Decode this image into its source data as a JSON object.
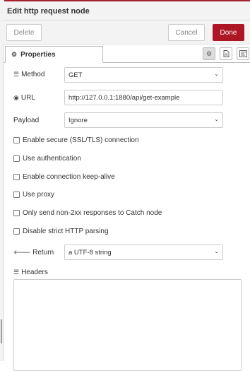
{
  "tray": {
    "title": "Edit http request node"
  },
  "toolbar": {
    "delete_label": "Delete",
    "cancel_label": "Cancel",
    "done_label": "Done"
  },
  "tabs": {
    "properties_label": "Properties"
  },
  "form": {
    "method": {
      "label": "Method",
      "value": "GET"
    },
    "url": {
      "label": "URL",
      "value": "http://127.0.0.1:1880/api/get-example"
    },
    "payload": {
      "label": "Payload",
      "value": "Ignore"
    },
    "checks": [
      {
        "label": "Enable secure (SSL/TLS) connection",
        "checked": false
      },
      {
        "label": "Use authentication",
        "checked": false
      },
      {
        "label": "Enable connection keep-alive",
        "checked": false
      },
      {
        "label": "Use proxy",
        "checked": false
      },
      {
        "label": "Only send non-2xx responses to Catch node",
        "checked": false
      },
      {
        "label": "Disable strict HTTP parsing",
        "checked": false
      }
    ],
    "ret": {
      "label": "Return",
      "value": "a UTF-8 string"
    },
    "headers": {
      "label": "Headers"
    }
  },
  "icons": {
    "tab_properties": "gear-icon",
    "method": "list-icon",
    "url": "globe-icon",
    "ret": "arrow-left-icon",
    "headers": "list-icon",
    "tab1": "gear-icon",
    "tab2": "file-icon",
    "tab3": "appearance-icon"
  },
  "colors": {
    "accent": "#ad1625",
    "top_line": "#a4202e"
  }
}
